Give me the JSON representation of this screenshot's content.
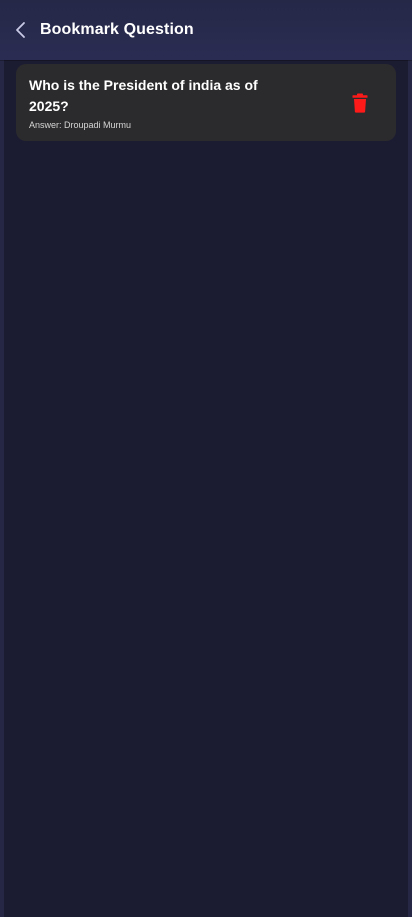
{
  "header": {
    "title": "Bookmark Question",
    "back_icon": "chevron-left-icon"
  },
  "bookmarks": [
    {
      "question": "Who is the President of india as of 2025?",
      "answer": "Answer: Droupadi Murmu",
      "delete_icon": "trash-icon",
      "delete_color": "#ff1a1a"
    }
  ],
  "colors": {
    "background": "#1b1b32",
    "app_bar": "#2a2c52",
    "card": "#2b2b2d"
  }
}
